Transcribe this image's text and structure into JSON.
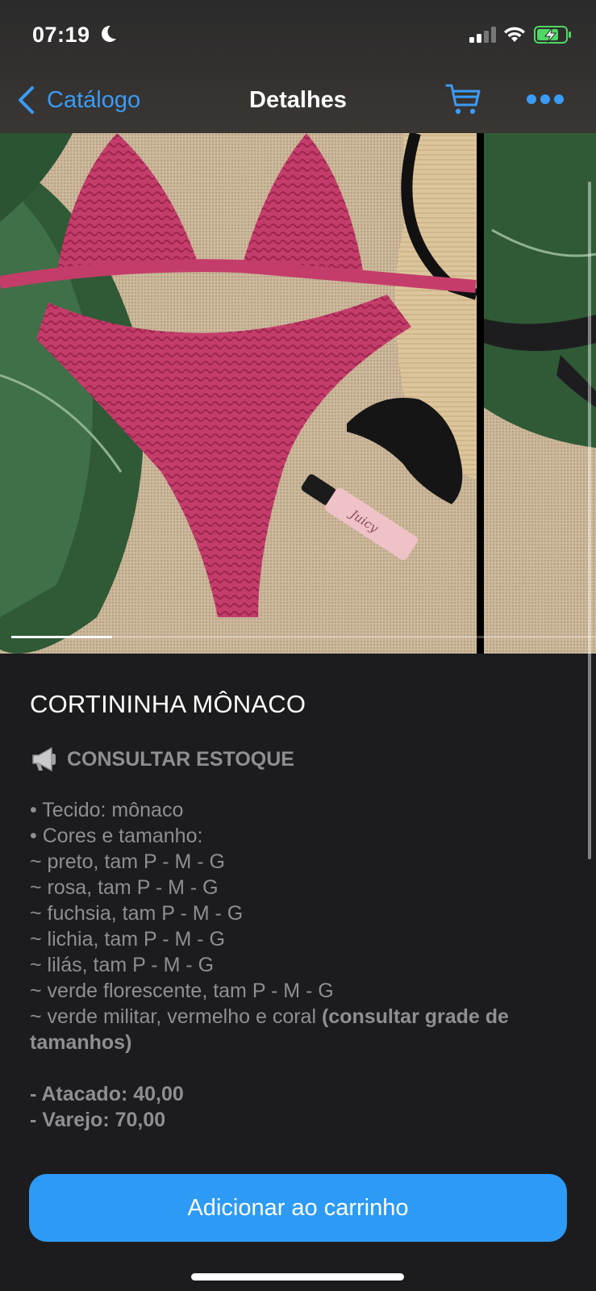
{
  "status_bar": {
    "time": "07:19"
  },
  "nav": {
    "back_label": "Catálogo",
    "title": "Detalhes"
  },
  "product": {
    "title": "CORTININHA MÔNACO",
    "stock_label": "CONSULTAR ESTOQUE",
    "description": [
      "• Tecido: mônaco",
      "• Cores e tamanho:",
      "~ preto, tam P - M - G",
      "~ rosa, tam P - M - G",
      "~ fuchsia, tam P - M - G",
      "~ lichia, tam P - M - G",
      "~ lilás, tam P - M - G",
      "~ verde florescente, tam P - M - G"
    ],
    "description_last": "~ verde militar, vermelho e coral ",
    "description_last_bold": "(consultar grade de tamanhos)",
    "prices": [
      "- Atacado: 40,00",
      "- Varejo: 70,00"
    ]
  },
  "actions": {
    "add_to_cart": "Adicionar ao carrinho"
  },
  "icons": {
    "back": "chevron-left-icon",
    "cart": "cart-icon",
    "more": "more-icon",
    "stock": "megaphone-icon"
  },
  "colors": {
    "accent": "#2d9bf5",
    "background": "#1c1c1e",
    "secondary_text": "#8e8e93",
    "battery_green": "#4cd964"
  }
}
